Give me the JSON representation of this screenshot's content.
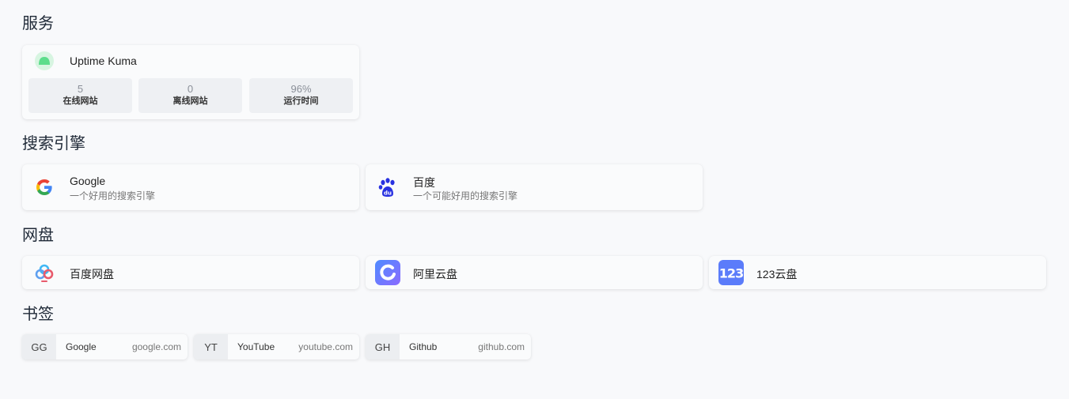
{
  "sections": {
    "services": "服务",
    "search": "搜索引擎",
    "disk": "网盘",
    "bookmarks": "书签"
  },
  "uptime": {
    "name": "Uptime Kuma",
    "icon": "uptime-kuma-icon",
    "stats": [
      {
        "value": "5",
        "label": "在线网站"
      },
      {
        "value": "0",
        "label": "离线网站"
      },
      {
        "value": "96%",
        "label": "运行时间"
      }
    ]
  },
  "search_engines": [
    {
      "name": "Google",
      "desc": "一个好用的搜索引擎",
      "icon": "google-icon"
    },
    {
      "name": "百度",
      "desc": "一个可能好用的搜索引擎",
      "icon": "baidu-icon"
    }
  ],
  "disks": [
    {
      "name": "百度网盘",
      "icon": "baidu-netdisk-icon"
    },
    {
      "name": "阿里云盘",
      "icon": "aliyun-drive-icon"
    },
    {
      "name": "123云盘",
      "icon": "123-pan-icon"
    }
  ],
  "bookmarks": [
    {
      "abbr": "GG",
      "name": "Google",
      "url": "google.com"
    },
    {
      "abbr": "YT",
      "name": "YouTube",
      "url": "youtube.com"
    },
    {
      "abbr": "GH",
      "name": "Github",
      "url": "github.com"
    }
  ],
  "colors": {
    "background": "#f8f9fb",
    "card": "#fafbfc",
    "uptime_green": "#5cdd8b",
    "baidu_blue": "#2932e1",
    "aliyun": "#6c7dff",
    "pan123": "#5b7cfa"
  }
}
